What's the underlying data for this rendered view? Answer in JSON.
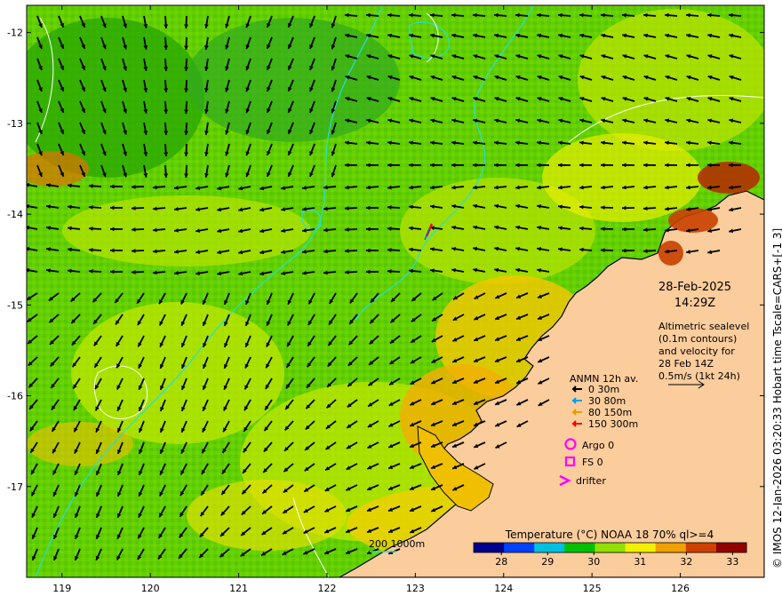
{
  "map": {
    "date": "28-Feb-2025",
    "time": "14:29Z",
    "lon_ticks": [
      119,
      120,
      121,
      122,
      123,
      124,
      125,
      126
    ],
    "lat_ticks": [
      -12,
      -13,
      -14,
      -15,
      -16,
      -17
    ],
    "lon_range": [
      118.6,
      126.95
    ],
    "lat_range": [
      -11.7,
      -18.0
    ]
  },
  "altimetry_note": {
    "lines": [
      "Altimetric sealevel",
      "(0.1m contours)",
      "and velocity for",
      "28 Feb 14Z",
      "0.5m/s (1kt 24h)"
    ]
  },
  "anmn_legend": {
    "title": "ANMN 12h av.",
    "items": [
      {
        "label": "0 30m",
        "color": "#000000"
      },
      {
        "label": "30 80m",
        "color": "#00a0ff"
      },
      {
        "label": "80 150m",
        "color": "#e8a000"
      },
      {
        "label": "150 300m",
        "color": "#ff0000"
      }
    ]
  },
  "markers": {
    "argo": "Argo 0",
    "fs": "FS 0",
    "drifter": "drifter"
  },
  "colorbar": {
    "title": "Temperature (°C) NOAA 18 70% ql>=4",
    "ticks": [
      28,
      29,
      30,
      31,
      32,
      33
    ],
    "range": [
      27.4,
      33.3
    ],
    "colors": [
      "#00008c",
      "#0040ff",
      "#00c0e0",
      "#00c000",
      "#90e000",
      "#f0f000",
      "#f0a000",
      "#d04000",
      "#900000"
    ]
  },
  "depth_legend": "200  1000m",
  "credit": "© IMOS 12-Jan-2026 03:20:33 Hobart time Tscale=CARS+[-1 3]"
}
